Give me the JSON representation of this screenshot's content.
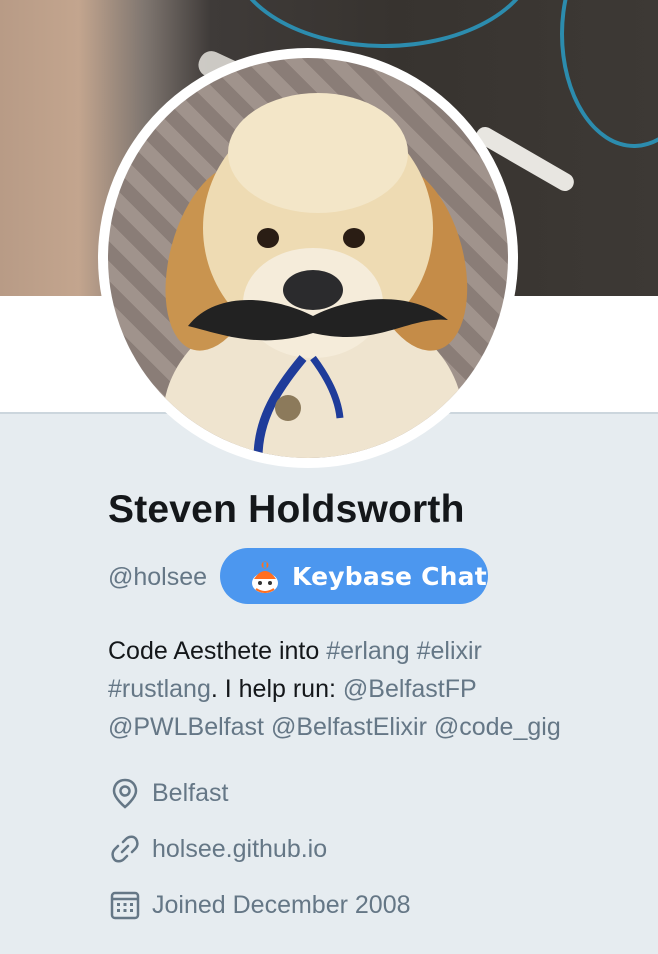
{
  "profile": {
    "name": "Steven Holdsworth",
    "handle": "@holsee",
    "keybase_button": "Keybase Chat",
    "bio": {
      "text1": "Code Aesthete into ",
      "tag_erlang": "#erlang",
      "space1": " ",
      "tag_elixir": "#elixir",
      "tag_rustlang": "#rustlang",
      "text2": ". I help run: ",
      "mention_belfastfp": "@BelfastFP",
      "mention_pwlbelfast": "@PWLBelfast",
      "mention_belfastelixir": "@BelfastElixir",
      "mention_codegig": "@code_gig"
    },
    "location": "Belfast",
    "url": "holsee.github.io",
    "joined": "Joined December 2008"
  },
  "icons": {
    "location": "location-pin-icon",
    "url": "link-icon",
    "joined": "calendar-icon",
    "keybase": "keybase-icon"
  },
  "colors": {
    "background": "#e6ecf0",
    "link": "#657786",
    "text": "#14171a",
    "button": "#4c97ef"
  }
}
